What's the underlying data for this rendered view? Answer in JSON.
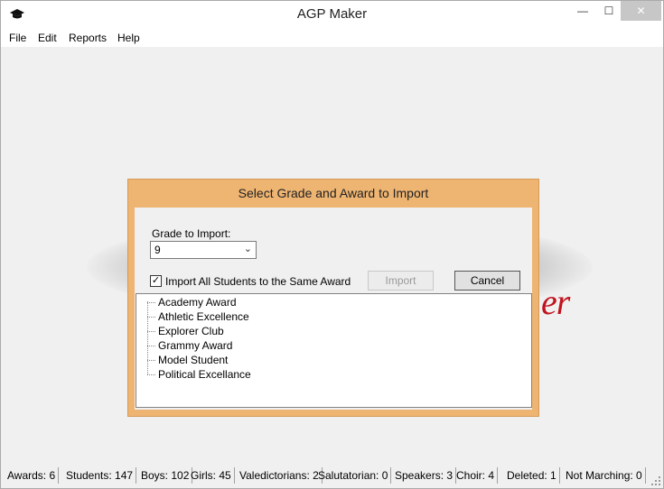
{
  "window": {
    "title": "AGP Maker",
    "min_glyph": "—",
    "max_glyph": "☐",
    "close_glyph": "✕"
  },
  "menu": [
    "File",
    "Edit",
    "Reports",
    "Help"
  ],
  "logo": {
    "text": "er"
  },
  "dialog": {
    "title": "Select Grade and Award to Import",
    "grade_label": "Grade to Import:",
    "grade_value": "9",
    "same_award_label": "Import All Students to the Same Award",
    "same_award_checked": true,
    "import_button": "Import",
    "cancel_button": "Cancel",
    "awards": [
      "Academy Award",
      "Athletic Excellence",
      "Explorer Club",
      "Grammy Award",
      "Model Student",
      "Political Excellance"
    ]
  },
  "status": [
    "Awards: 6",
    "Students: 147",
    "Boys: 102",
    "Girls: 45",
    "Valedictorians: 2",
    "Salutatorian: 0",
    "Speakers: 3",
    "Choir: 4",
    "Deleted: 1",
    "Not Marching: 0"
  ]
}
